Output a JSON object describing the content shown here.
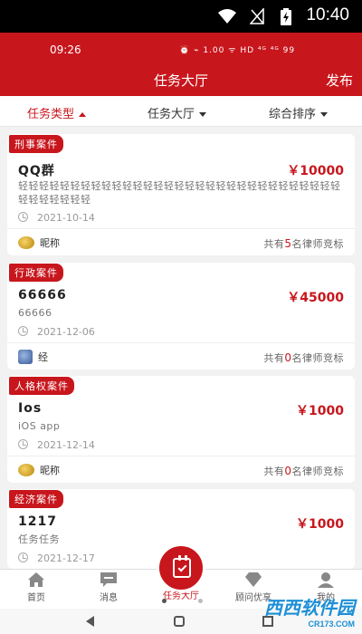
{
  "status_bar": {
    "time": "10:40"
  },
  "inner_status": {
    "time": "09:26",
    "icons_text": "⏰ ⌁ 1.00 ᯤ HD ⁴ᴳ ⁴ᴳ 99"
  },
  "header": {
    "title": "任务大厅",
    "publish_label": "发布"
  },
  "filters": [
    {
      "label": "任务类型",
      "active": true
    },
    {
      "label": "任务大厅",
      "active": false
    },
    {
      "label": "综合排序",
      "active": false
    }
  ],
  "cards": [
    {
      "category": "刑事案件",
      "title": "QQ群",
      "price": "￥10000",
      "description": "轻轻轻轻轻轻轻轻轻轻轻轻轻轻轻轻轻轻轻轻轻轻轻轻轻轻轻轻轻轻轻轻轻轻轻轻轻轻",
      "date": "2021-10-14",
      "user": "昵称",
      "bid_prefix": "共有",
      "bid_count": "5",
      "bid_suffix": "名律师竞标"
    },
    {
      "category": "行政案件",
      "title": "66666",
      "price": "￥45000",
      "description": "66666",
      "date": "2021-12-06",
      "user": "经",
      "bid_prefix": "共有",
      "bid_count": "0",
      "bid_suffix": "名律师竞标"
    },
    {
      "category": "人格权案件",
      "title": "Ios",
      "price": "￥1000",
      "description": "iOS app",
      "date": "2021-12-14",
      "user": "昵称",
      "bid_prefix": "共有",
      "bid_count": "0",
      "bid_suffix": "名律师竞标"
    },
    {
      "category": "经济案件",
      "title": "1217",
      "price": "￥1000",
      "description": "任务任务",
      "date": "2021-12-17"
    }
  ],
  "bottom_nav": [
    {
      "label": "首页"
    },
    {
      "label": "消息"
    },
    {
      "label": "任务大厅"
    },
    {
      "label": "顾问优享"
    },
    {
      "label": "我的"
    }
  ],
  "watermark": {
    "main": "西西软件园",
    "sub": "CR173.COM"
  },
  "colors": {
    "brand_red": "#c8161d"
  }
}
